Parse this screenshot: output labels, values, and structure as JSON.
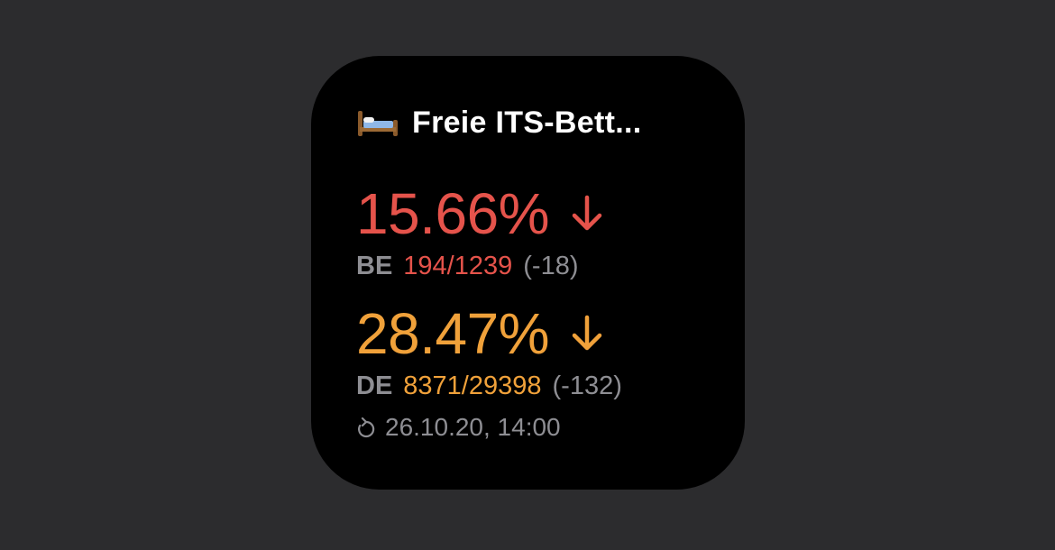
{
  "widget": {
    "title": "Freie ITS-Bett...",
    "title_icon": "bed-icon",
    "regions": [
      {
        "percent": "15.66%",
        "trend": "down",
        "trend_icon": "arrow-down-icon",
        "code": "BE",
        "beds": "194/1239",
        "delta": "(-18)",
        "color": "#e5534b"
      },
      {
        "percent": "28.47%",
        "trend": "down",
        "trend_icon": "arrow-down-icon",
        "code": "DE",
        "beds": "8371/29398",
        "delta": "(-132)",
        "color": "#f0a13a"
      }
    ],
    "updated_icon": "refresh-icon",
    "updated": "26.10.20, 14:00"
  },
  "colors": {
    "background": "#2c2c2e",
    "widget_background": "#000000",
    "secondary_text": "#8e8e93"
  }
}
